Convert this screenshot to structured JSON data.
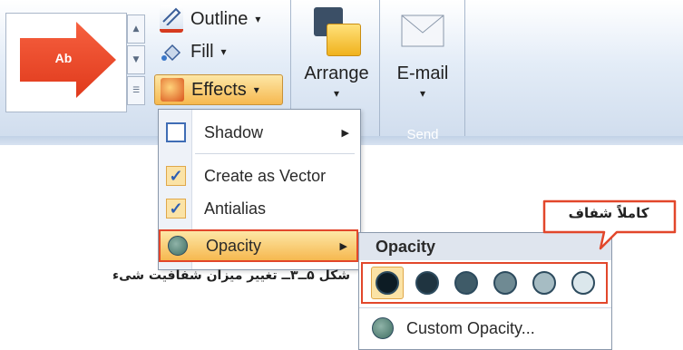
{
  "ribbon": {
    "shape_style_preview": "Ab",
    "commands": {
      "outline_label": "Outline",
      "fill_label": "Fill",
      "effects_label": "Effects",
      "dropdown_marker": "▾"
    },
    "arrange_label": "Arrange",
    "email_label": "E-mail",
    "send_group_label": "Send"
  },
  "effects_menu": {
    "items": [
      {
        "label": "Shadow",
        "has_submenu": true,
        "checked": false
      },
      {
        "label": "Create as Vector",
        "has_submenu": false,
        "checked": true
      },
      {
        "label": "Antialias",
        "has_submenu": false,
        "checked": true
      },
      {
        "label": "Opacity",
        "has_submenu": true,
        "checked": false,
        "highlighted": true
      }
    ],
    "submenu_marker": "▶",
    "check_mark": "✓"
  },
  "opacity_submenu": {
    "title": "Opacity",
    "swatches": [
      {
        "opacity": 1.0,
        "selected": true
      },
      {
        "opacity": 0.8,
        "selected": false
      },
      {
        "opacity": 0.6,
        "selected": false
      },
      {
        "opacity": 0.4,
        "selected": false
      },
      {
        "opacity": 0.2,
        "selected": false
      },
      {
        "opacity": 0.0,
        "selected": false
      }
    ],
    "custom_label": "Custom Opacity..."
  },
  "callout": {
    "text": "کاملاً شفاف"
  },
  "caption": {
    "text": "شکل ۵ــ۳ــ تغییر میزان شفافیت شیء"
  },
  "colors": {
    "highlight": "#f6b84f",
    "annotation_red": "#e2472b",
    "swatch_dark": "#0d1c24",
    "swatch_light": "#dbe7ec"
  }
}
